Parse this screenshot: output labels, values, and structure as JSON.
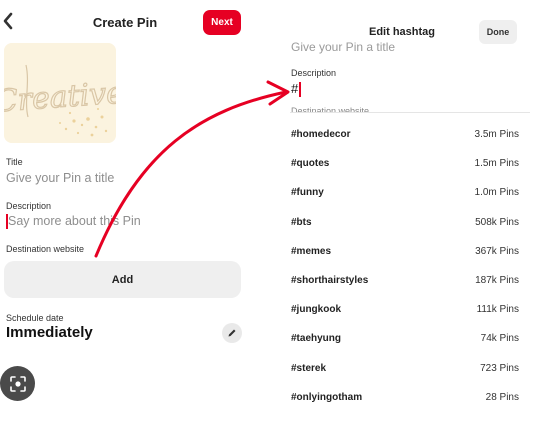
{
  "create_pin": {
    "back_icon": "chevron-left-icon",
    "title": "Create Pin",
    "next_label": "Next",
    "image_text": "Creative",
    "title_field": {
      "label": "Title",
      "placeholder": "Give your Pin a title"
    },
    "description_field": {
      "label": "Description",
      "placeholder": "Say more about this Pin"
    },
    "destination_label": "Destination website",
    "add_label": "Add",
    "schedule_label": "Schedule date",
    "schedule_value": "Immediately",
    "edit_icon": "pencil-icon",
    "lens_icon": "lens-icon"
  },
  "edit_hashtag": {
    "title": "Edit hashtag",
    "done_label": "Done",
    "title_placeholder": "Give your Pin a title",
    "description_label": "Description",
    "description_value": "#",
    "destination_label": "Destination website",
    "suggestions": [
      {
        "tag": "#homedecor",
        "count": "3.5m Pins"
      },
      {
        "tag": "#quotes",
        "count": "1.5m Pins"
      },
      {
        "tag": "#funny",
        "count": "1.0m Pins"
      },
      {
        "tag": "#bts",
        "count": "508k Pins"
      },
      {
        "tag": "#memes",
        "count": "367k Pins"
      },
      {
        "tag": "#shorthairstyles",
        "count": "187k Pins"
      },
      {
        "tag": "#jungkook",
        "count": "111k Pins"
      },
      {
        "tag": "#taehyung",
        "count": "74k Pins"
      },
      {
        "tag": "#sterek",
        "count": "723 Pins"
      },
      {
        "tag": "#onlyingotham",
        "count": "28 Pins"
      }
    ]
  },
  "colors": {
    "accent": "#e60023",
    "button_gray": "#efefef",
    "placeholder": "#8e8e8e"
  }
}
